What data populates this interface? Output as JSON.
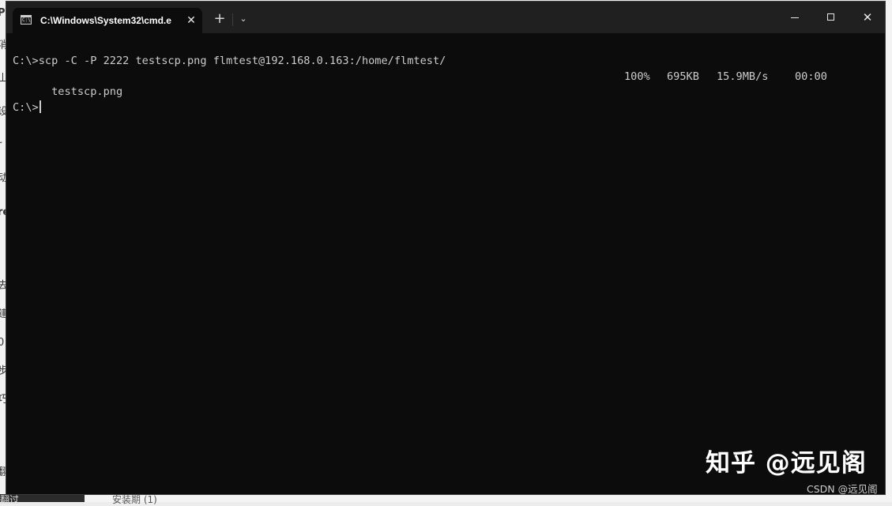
{
  "background": {
    "left_glyphs": [
      "P",
      "消",
      "山",
      "设",
      "r",
      "动",
      "re",
      "去",
      "建",
      "0",
      "步",
      "巧",
      "翻"
    ],
    "bottom_left_text": "翻过",
    "bottom_text": "安装期 (1)"
  },
  "window": {
    "tab": {
      "icon": "cmd-icon",
      "icon_text": "C:\\",
      "title": "C:\\Windows\\System32\\cmd.e",
      "close_glyph": "✕"
    },
    "new_tab_glyph": "+",
    "dropdown_glyph": "⌄",
    "controls": {
      "close_glyph": "✕"
    }
  },
  "console": {
    "command_line": "C:\\>scp -C -P 2222 testscp.png flmtest@192.168.0.163:/home/flmtest/",
    "transfer": {
      "file": "testscp.png",
      "percent": "100%",
      "size": "695KB",
      "rate": "15.9MB/s",
      "time": "00:00"
    },
    "prompt": "C:\\>"
  },
  "watermark": {
    "main": "知乎 @远见阁",
    "sub": "CSDN @远见阁"
  },
  "colors": {
    "terminal_bg": "#0c0c0c",
    "titlebar_bg": "#202020",
    "text": "#cccccc"
  }
}
